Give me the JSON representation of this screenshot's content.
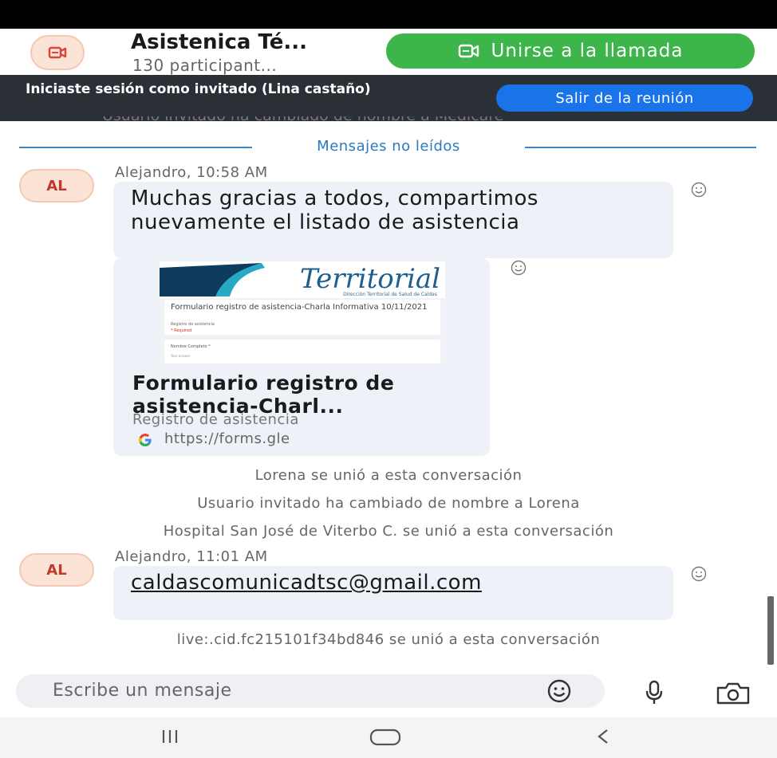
{
  "header": {
    "title": "Asistenica Té...",
    "participants": "130 participant...",
    "join_label": "Unirse a la llamada",
    "join_color": "#3db54a"
  },
  "guest_bar": {
    "text": "Iniciaste sesión como invitado (Lina castaño)",
    "leave_label": "Salir de la reunión",
    "leave_color": "#1a73e8"
  },
  "chat": {
    "ghost_text": "Usuario invitado ha cambiado de nombre a Medicare",
    "unread_divider": "Mensajes no leídos",
    "messages": [
      {
        "avatar": "AL",
        "sender": "Alejandro, 10:58 AM",
        "text": "Muchas gracias a todos, compartimos nuevamente el listado de asistencia",
        "link_card": {
          "thumb_logo": "Territorial",
          "thumb_tagline": "Dirección Territorial de Salud de Caldas",
          "thumb_form_title": "Formulario registro de asistencia-Charla Informativa 10/11/2021",
          "thumb_form_sub": "Registro de asistencia",
          "thumb_form_required": "* Required",
          "thumb_field_label": "Nombre Completo *",
          "thumb_field_input": "Your answer",
          "title": "Formulario registro de asistencia-Charl...",
          "description": "Registro de asistencia",
          "url": "https://forms.gle",
          "icon": "google-icon"
        }
      },
      {
        "avatar": "AL",
        "sender": "Alejandro, 11:01 AM",
        "email": "caldascomunicadtsc@gmail.com"
      }
    ],
    "system_messages": [
      "Lorena se unió a esta conversación",
      "Usuario invitado ha cambiado de nombre a Lorena",
      "Hospital San José de Viterbo C. se unió a esta conversación",
      "live:.cid.fc215101f34bd846 se unió a esta conversación"
    ]
  },
  "composer": {
    "placeholder": "Escribe un mensaje",
    "icons": [
      "emoji-icon",
      "microphone-icon",
      "camera-icon"
    ]
  },
  "nav": {
    "icons": [
      "recent-apps-icon",
      "home-icon",
      "back-icon"
    ]
  }
}
